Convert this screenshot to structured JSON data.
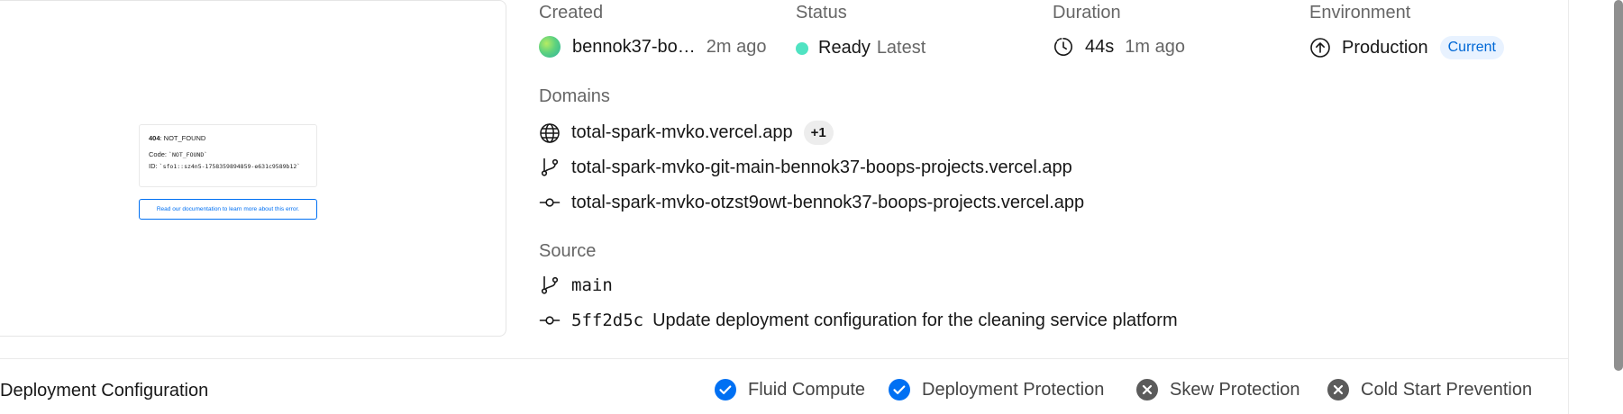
{
  "preview": {
    "error_code_num": "404",
    "error_code_text": ": NOT_FOUND",
    "code_prefix": "Code: ",
    "code_value": "`NOT_FOUND`",
    "id_prefix": "ID: ",
    "id_value": "`sfo1::sz4n5-1758359894859-e631c9589b12`",
    "doc_link": "Read our documentation to learn more about this error."
  },
  "created": {
    "label": "Created",
    "user": "bennok37-bo…",
    "time": "2m ago"
  },
  "status": {
    "label": "Status",
    "value": "Ready",
    "tag": "Latest",
    "dot_color": "#50e3c2"
  },
  "duration": {
    "label": "Duration",
    "value": "44s",
    "ago": "1m ago"
  },
  "environment": {
    "label": "Environment",
    "value": "Production",
    "badge": "Current"
  },
  "domains": {
    "label": "Domains",
    "primary": "total-spark-mvko.vercel.app",
    "extra_count": "+1",
    "branch_url": "total-spark-mvko-git-main-bennok37-boops-projects.vercel.app",
    "commit_url": "total-spark-mvko-otzst9owt-bennok37-boops-projects.vercel.app"
  },
  "source": {
    "label": "Source",
    "branch": "main",
    "commit_hash": "5ff2d5c",
    "commit_message": "Update deployment configuration for the cleaning service platform"
  },
  "deployment_config": {
    "title": "Deployment Configuration",
    "features": [
      {
        "label": "Fluid Compute",
        "enabled": true
      },
      {
        "label": "Deployment Protection",
        "enabled": true
      },
      {
        "label": "Skew Protection",
        "enabled": false
      },
      {
        "label": "Cold Start Prevention",
        "enabled": false
      }
    ]
  },
  "colors": {
    "accent_blue": "#0070f3",
    "disabled_gray": "#5b5b5b",
    "muted_text": "#666666"
  }
}
